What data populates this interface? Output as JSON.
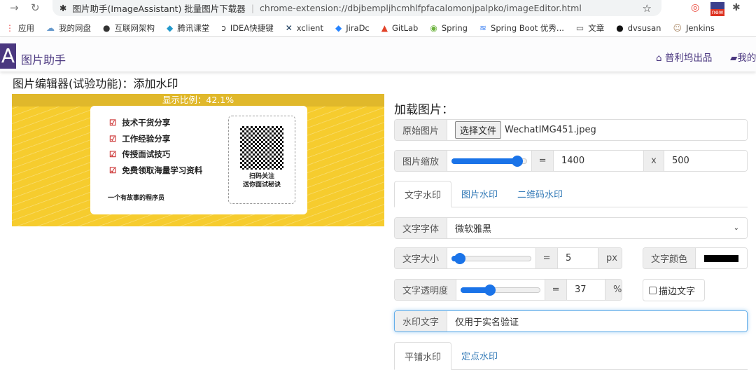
{
  "browser": {
    "tab_title": "图片助手(ImageAssistant) 批量图片下载器",
    "url": "chrome-extension://dbjbempljhcmhlfpfacalomonjpalpko/imageEditor.html",
    "ext_badge": "new",
    "bookmarks": [
      {
        "label": "应用",
        "icon": "apps-icon"
      },
      {
        "label": "我的网盘",
        "icon": "cloud-icon"
      },
      {
        "label": "互联网架构",
        "icon": "globe-icon"
      },
      {
        "label": "腾讯课堂",
        "icon": "tencent-icon"
      },
      {
        "label": "IDEA快捷键",
        "icon": "idea-icon"
      },
      {
        "label": "xclient",
        "icon": "x-icon"
      },
      {
        "label": "JiraDc",
        "icon": "jira-icon"
      },
      {
        "label": "GitLab",
        "icon": "gitlab-icon"
      },
      {
        "label": "Spring",
        "icon": "spring-icon"
      },
      {
        "label": "Spring Boot 优秀...",
        "icon": "springboot-icon"
      },
      {
        "label": "文章",
        "icon": "folder-icon"
      },
      {
        "label": "dvsusan",
        "icon": "github-icon"
      },
      {
        "label": "Jenkins",
        "icon": "jenkins-icon"
      }
    ]
  },
  "header": {
    "logo": "A",
    "brand": "图片助手",
    "nav": [
      "普利坞出品",
      "我的"
    ]
  },
  "page_title": "图片编辑器(试验功能)：添加水印",
  "preview": {
    "ratio_label": "显示比例：42.1%",
    "items": [
      "技术干货分享",
      "工作经验分享",
      "传授面试技巧",
      "免费领取海量学习资料"
    ],
    "tagline": "一个有故事的程序员",
    "qr_text": [
      "扫码关注",
      "送你面试秘诀"
    ]
  },
  "panel": {
    "load_title": "加载图片：",
    "original_label": "原始图片",
    "choose_file": "选择文件",
    "file_name": "WechatIMG451.jpeg",
    "scale_label": "图片缩放",
    "scale_slider": 0.88,
    "eq": "=",
    "width": "1400",
    "x": "x",
    "height": "500",
    "tabs": [
      "文字水印",
      "图片水印",
      "二维码水印"
    ],
    "font_label": "文字字体",
    "font_value": "微软雅黑",
    "size_label": "文字大小",
    "size_slider": 0.1,
    "size_value": "5",
    "size_unit": "px",
    "color_label": "文字颜色",
    "color_value": "#000000",
    "opacity_label": "文字透明度",
    "opacity_slider": 0.37,
    "opacity_value": "37",
    "opacity_unit": "%",
    "stroke_label": "描边文字",
    "text_label": "水印文字",
    "text_value": "仅用于实名验证",
    "mode_tabs": [
      "平铺水印",
      "定点水印"
    ]
  }
}
